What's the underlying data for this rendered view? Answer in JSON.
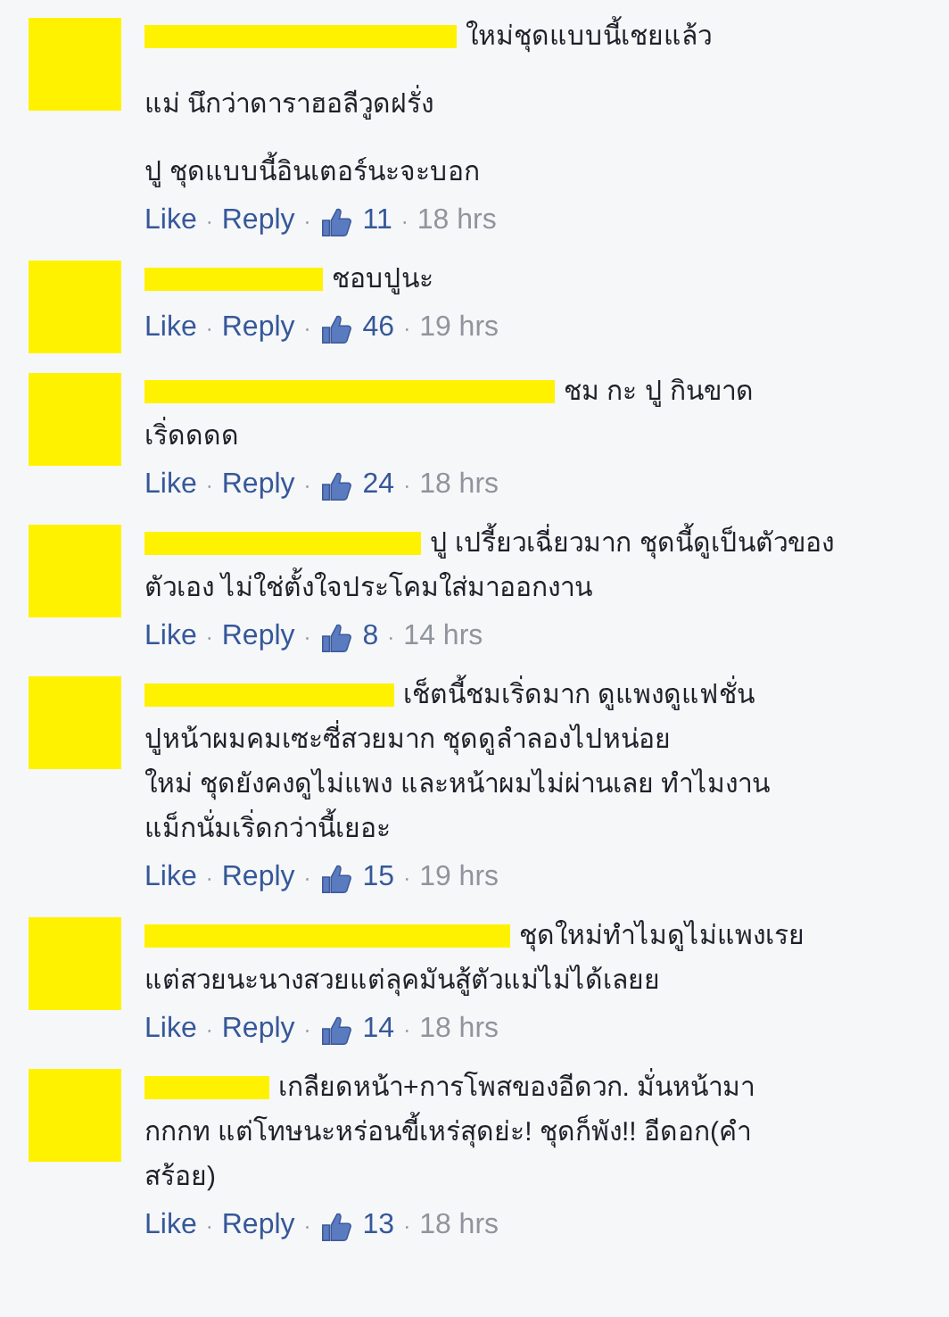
{
  "comments": [
    {
      "paragraphs": [
        [
          "ใหม่ชุดแบบนี้เชยแล้ว"
        ],
        [
          "แม่ นึกว่าดาราฮอลีวูดฝรั่ง"
        ],
        [
          "ปู ชุดแบบนี้อินเตอร์นะจะบอก"
        ]
      ],
      "like": "Like",
      "reply": "Reply",
      "likes": "11",
      "time": "18 hrs",
      "separators": [
        "·",
        "·",
        "·"
      ]
    },
    {
      "paragraphs": [
        [
          "ชอบปูนะ"
        ]
      ],
      "like": "Like",
      "reply": "Reply",
      "likes": "46",
      "time": "19 hrs",
      "separators": [
        "·",
        "·",
        "·"
      ]
    },
    {
      "paragraphs": [
        [
          "ชม กะ ปู กินขาด",
          "เริ่ดดดด"
        ]
      ],
      "like": "Like",
      "reply": "Reply",
      "likes": "24",
      "time": "18 hrs",
      "separators": [
        "·",
        "·",
        "·"
      ]
    },
    {
      "paragraphs": [
        [
          "ปู เปรี้ยวเฉี่ยวมาก ชุดนี้ดูเป็นตัวของ",
          "ตัวเอง ไม่ใช่ตั้งใจประโคมใส่มาออกงาน"
        ]
      ],
      "like": "Like",
      "reply": "Reply",
      "likes": "8",
      "time": "14 hrs",
      "separators": [
        "·",
        "·",
        "·"
      ]
    },
    {
      "paragraphs": [
        [
          "เช็ตนี้ชมเริ่ดมาก ดูแพงดูแฟชั่น",
          "ปูหน้าผมคมเซะซี่สวยมาก ชุดดูลำลองไปหน่อย",
          "ใหม่ ชุดยังคงดูไม่แพง และหน้าผมไม่ผ่านเลย ทำไมงาน",
          "แม็กนั่มเริ่ดกว่านี้เยอะ"
        ]
      ],
      "like": "Like",
      "reply": "Reply",
      "likes": "15",
      "time": "19 hrs",
      "separators": [
        "·",
        "·",
        "·"
      ]
    },
    {
      "paragraphs": [
        [
          "ชุดใหม่ทำไมดูไม่แพงเรย",
          "แต่สวยนะนางสวยแต่ลุคมันสู้ตัวแม่ไม่ได้เลยย"
        ]
      ],
      "like": "Like",
      "reply": "Reply",
      "likes": "14",
      "time": "18 hrs",
      "separators": [
        "·",
        "·",
        "·"
      ]
    },
    {
      "paragraphs": [
        [
          "เกลียดหน้า+การโพสของอีดวก. มั่นหน้ามา",
          "กกกท แต่โทษนะหร่อนขี้เหร่สุดย่ะ! ชุดก็พัง!! อีดอก(คำ",
          "สร้อย)"
        ]
      ],
      "like": "Like",
      "reply": "Reply",
      "likes": "13",
      "time": "18 hrs",
      "separators": [
        "·",
        "·",
        "·"
      ]
    }
  ]
}
